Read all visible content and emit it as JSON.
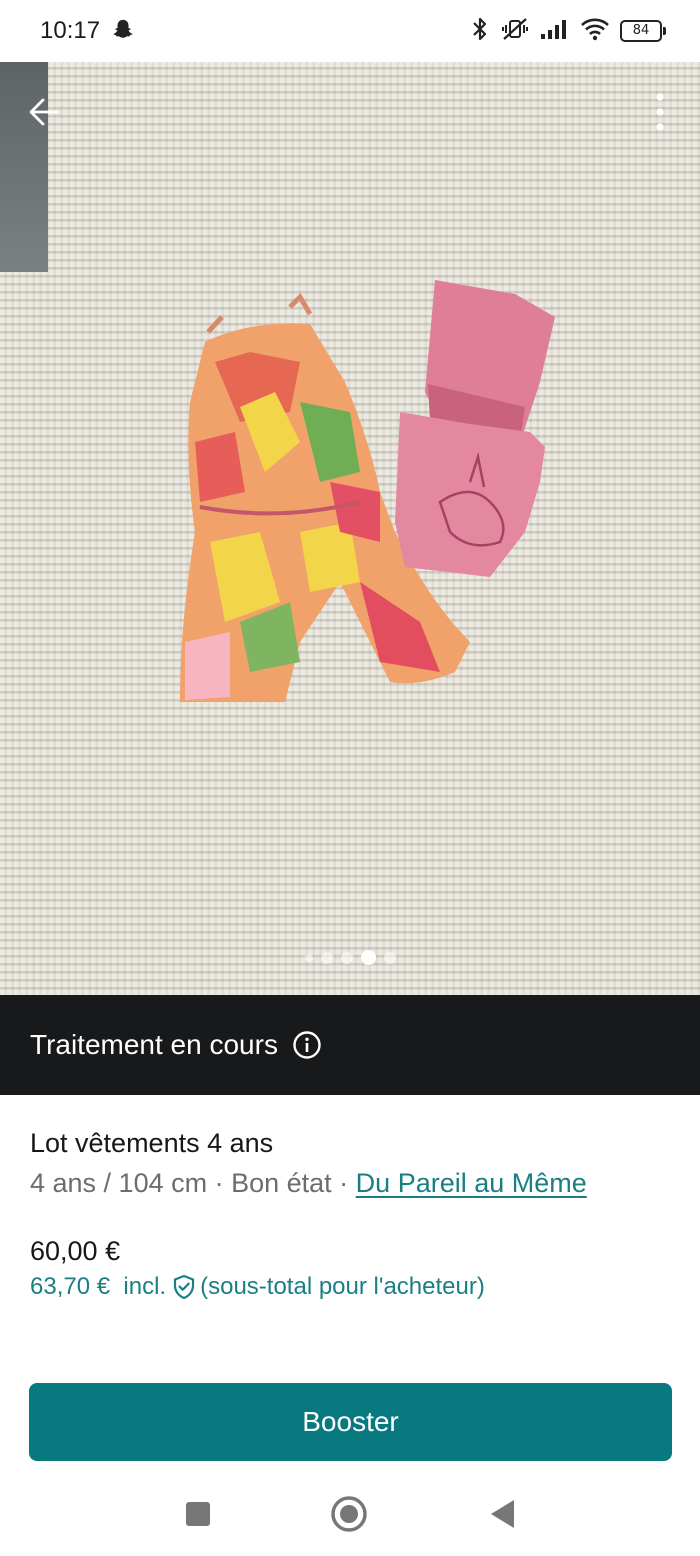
{
  "status_bar": {
    "time": "10:17",
    "notification_icon": "snapchat-ghost-icon",
    "battery": "84"
  },
  "photo": {
    "description_icons": [
      "back-arrow-icon",
      "more-vertical-icon"
    ],
    "carousel": {
      "total": 5,
      "active_index": 3
    }
  },
  "processing_banner": {
    "text": "Traitement en cours"
  },
  "item": {
    "title": "Lot vêtements 4 ans",
    "meta_prefix": "4 ans / 104 cm · Bon état · ",
    "brand": "Du Pareil au Même",
    "price": "60,00 €",
    "buyer_price": "63,70 €",
    "buyer_incl": "incl.",
    "buyer_note": "(sous-total pour l'acheteur)"
  },
  "actions": {
    "booster_label": "Booster"
  },
  "colors": {
    "accent": "#087a7f",
    "link": "#1a7f83",
    "banner_bg": "#17191a"
  }
}
